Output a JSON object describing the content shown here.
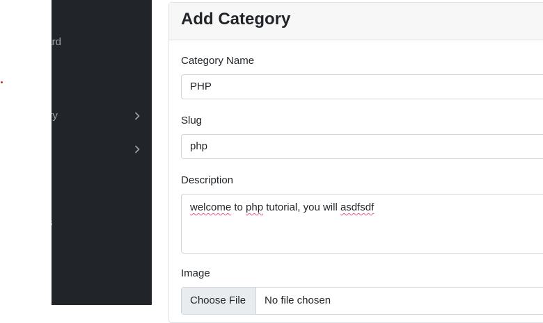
{
  "sidebar": {
    "items": [
      {
        "label": "Dashboard",
        "visible_label": "oard",
        "icon": "dashboard-icon",
        "has_chevron": false
      },
      {
        "label": "Category",
        "visible_label": "ory",
        "icon": "category-icon",
        "has_chevron": true
      },
      {
        "label": "",
        "visible_label": "",
        "icon": "menu-icon",
        "has_chevron": true
      },
      {
        "label": "Users",
        "visible_label": "s",
        "icon": "users-icon",
        "has_chevron": false
      }
    ]
  },
  "page": {
    "title": "Add Category"
  },
  "form": {
    "category_name": {
      "label": "Category Name",
      "value": "PHP"
    },
    "slug": {
      "label": "Slug",
      "value": "php"
    },
    "description": {
      "label": "Description",
      "value": "welcome to php tutorial, you will asdfsdf",
      "segments": [
        "welcome",
        " to ",
        "php",
        " tutorial, you will ",
        "asdfsdf"
      ]
    },
    "image": {
      "label": "Image",
      "button_label": "Choose File",
      "status": "No file chosen"
    }
  },
  "colors": {
    "sidebar_bg": "#212529",
    "sidebar_text": "#9da3a9",
    "header_bg": "#f7f7f7",
    "border": "#ced4da"
  }
}
